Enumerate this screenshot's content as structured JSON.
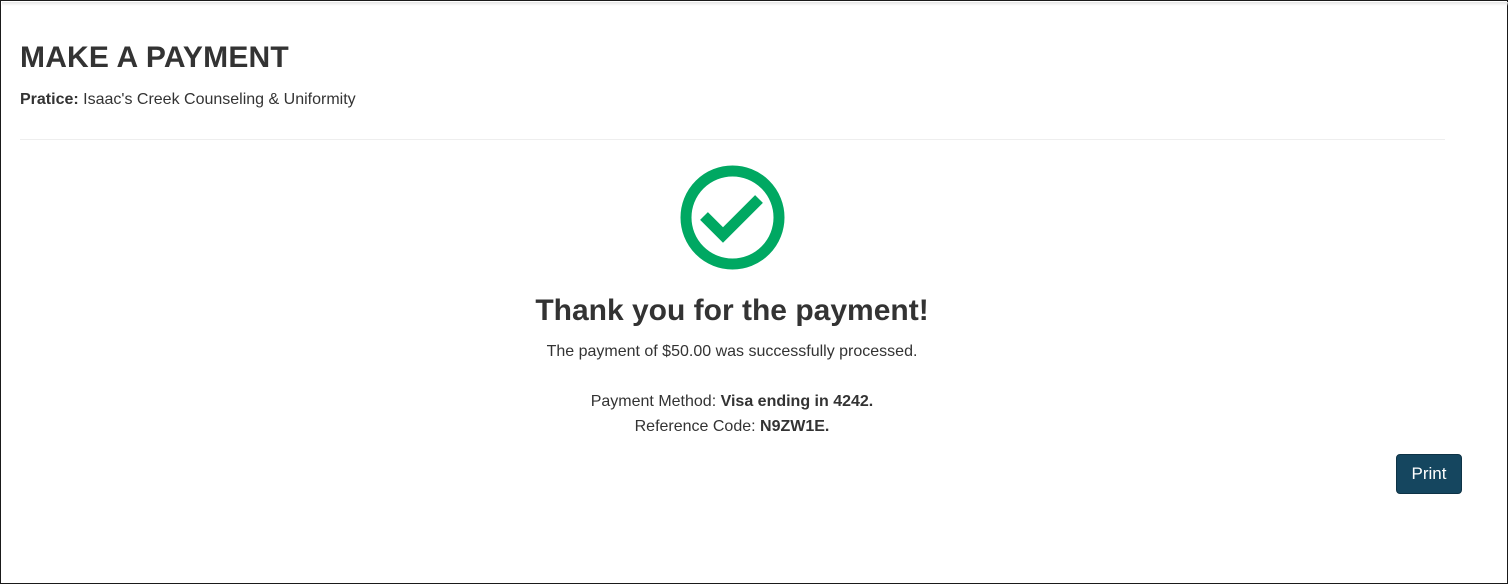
{
  "page": {
    "title": "MAKE A PAYMENT",
    "practice_label": "Pratice:",
    "practice_name": "Isaac's Creek Counseling & Uniformity"
  },
  "confirmation": {
    "icon": "check-circle-icon",
    "icon_color": "#00a862",
    "heading": "Thank you for the payment!",
    "message": "The payment of $50.00 was successfully processed.",
    "method_label": "Payment Method:",
    "method_value": "Visa ending in 4242.",
    "reference_label": "Reference Code:",
    "reference_value": "N9ZW1E."
  },
  "actions": {
    "print_label": "Print",
    "print_color": "#15465f"
  }
}
